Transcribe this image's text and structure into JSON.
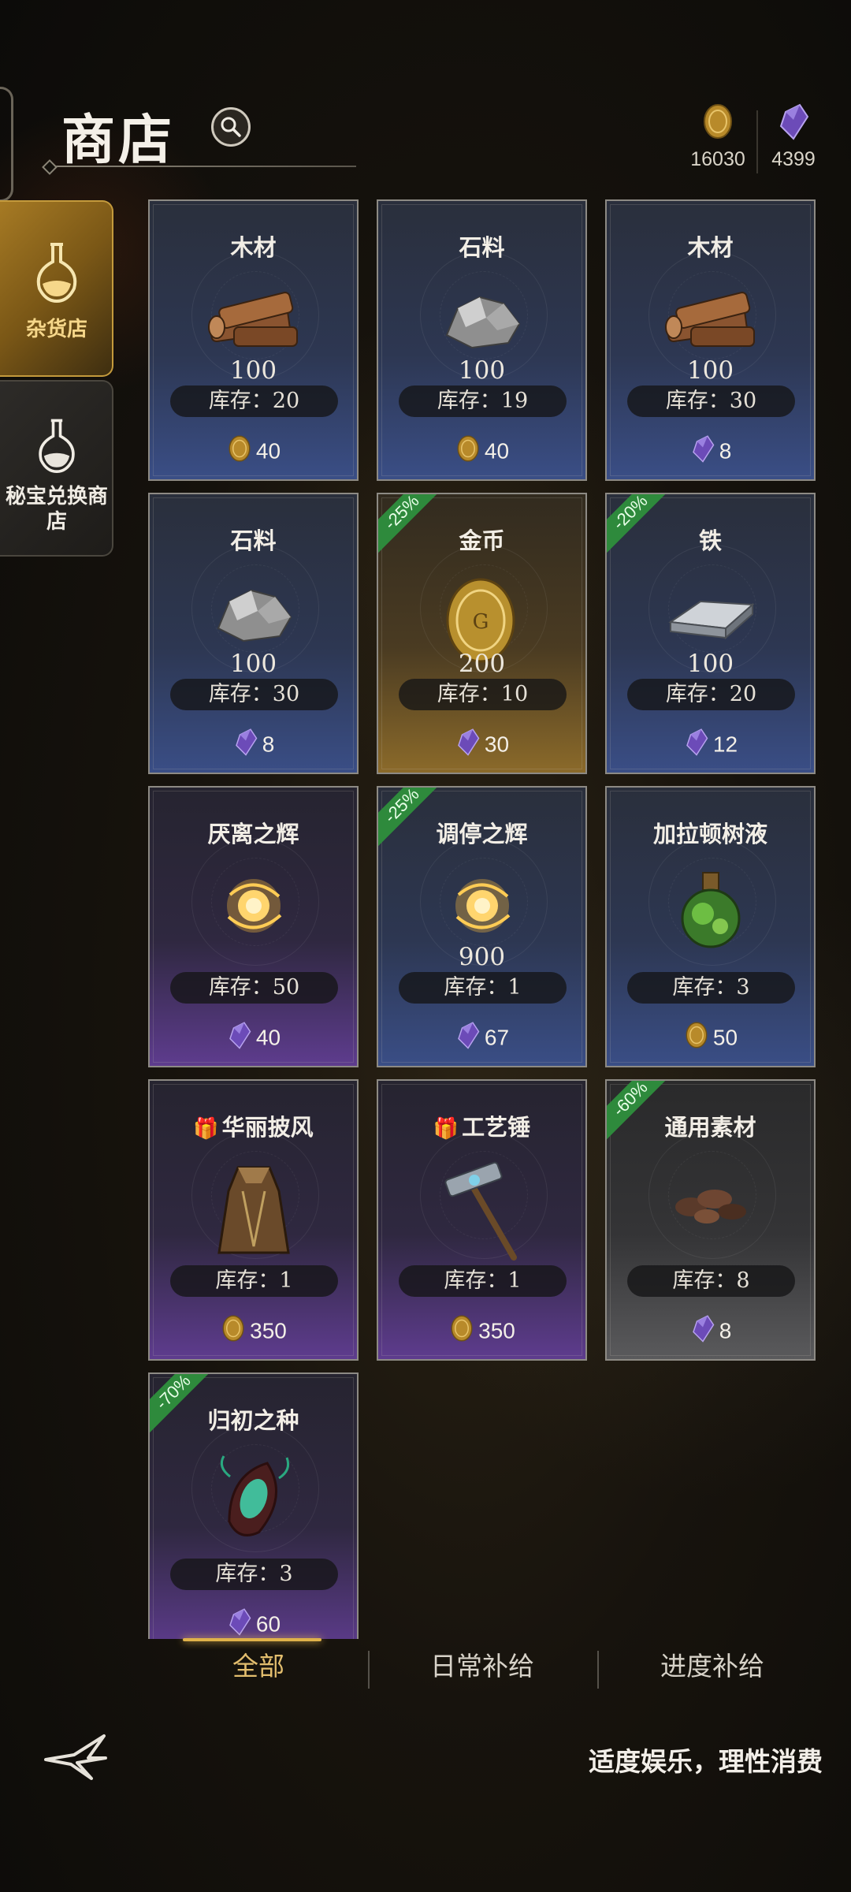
{
  "header": {
    "title": "商店",
    "currency": [
      {
        "name": "gold-coin",
        "value": "16030"
      },
      {
        "name": "purple-gem",
        "value": "4399"
      }
    ]
  },
  "sidebar": {
    "tabs": [
      {
        "label": "杂货店",
        "icon": "flask-icon",
        "active": true
      },
      {
        "label": "秘宝兑换商店",
        "icon": "flask-icon",
        "active": false
      }
    ]
  },
  "items": [
    {
      "name": "木材",
      "qty": "100",
      "stock": "库存：20",
      "price": "40",
      "currency": "gold-coin",
      "rarity": "blue",
      "icon": "wood-icon",
      "discount": "",
      "gift": false
    },
    {
      "name": "石料",
      "qty": "100",
      "stock": "库存：19",
      "price": "40",
      "currency": "gold-coin",
      "rarity": "blue",
      "icon": "stone-icon",
      "discount": "",
      "gift": false
    },
    {
      "name": "木材",
      "qty": "100",
      "stock": "库存：30",
      "price": "8",
      "currency": "purple-gem",
      "rarity": "blue",
      "icon": "wood-icon",
      "discount": "",
      "gift": false
    },
    {
      "name": "石料",
      "qty": "100",
      "stock": "库存：30",
      "price": "8",
      "currency": "purple-gem",
      "rarity": "blue",
      "icon": "stone-icon",
      "discount": "",
      "gift": false
    },
    {
      "name": "金币",
      "qty": "200",
      "stock": "库存：10",
      "price": "30",
      "currency": "purple-gem",
      "rarity": "gold",
      "icon": "gold-coin-icon",
      "discount": "-25%",
      "gift": false
    },
    {
      "name": "铁",
      "qty": "100",
      "stock": "库存：20",
      "price": "12",
      "currency": "purple-gem",
      "rarity": "blue",
      "icon": "iron-ingot-icon",
      "discount": "-20%",
      "gift": false
    },
    {
      "name": "厌离之辉",
      "qty": "",
      "stock": "库存：50",
      "price": "40",
      "currency": "purple-gem",
      "rarity": "purple",
      "icon": "radiance-icon",
      "discount": "",
      "gift": false
    },
    {
      "name": "调停之辉",
      "qty": "900",
      "stock": "库存：1",
      "price": "67",
      "currency": "purple-gem",
      "rarity": "blue",
      "icon": "radiance-icon",
      "discount": "-25%",
      "gift": false
    },
    {
      "name": "加拉顿树液",
      "qty": "",
      "stock": "库存：3",
      "price": "50",
      "currency": "gold-coin",
      "rarity": "blue",
      "icon": "potion-icon",
      "discount": "",
      "gift": false
    },
    {
      "name": "华丽披风",
      "qty": "",
      "stock": "库存：1",
      "price": "350",
      "currency": "gold-coin",
      "rarity": "purple",
      "icon": "cloak-icon",
      "discount": "",
      "gift": true
    },
    {
      "name": "工艺锤",
      "qty": "",
      "stock": "库存：1",
      "price": "350",
      "currency": "gold-coin",
      "rarity": "purple",
      "icon": "hammer-icon",
      "discount": "",
      "gift": true
    },
    {
      "name": "通用素材",
      "qty": "",
      "stock": "库存：8",
      "price": "8",
      "currency": "purple-gem",
      "rarity": "gray",
      "icon": "material-icon",
      "discount": "-60%",
      "gift": false
    },
    {
      "name": "归初之种",
      "qty": "",
      "stock": "库存：3",
      "price": "60",
      "currency": "purple-gem",
      "rarity": "purple",
      "icon": "seed-icon",
      "discount": "-70%",
      "gift": false
    }
  ],
  "bottom_tabs": [
    {
      "label": "全部",
      "active": true
    },
    {
      "label": "日常补给",
      "active": false
    },
    {
      "label": "进度补给",
      "active": false
    }
  ],
  "footer": {
    "note": "适度娱乐，理性消费"
  },
  "colors": {
    "accent_gold": "#e0b24a",
    "discount_green": "#2e8a3c",
    "rarity_blue": "#3a4e86",
    "rarity_purple": "#5e3c8e",
    "rarity_gold": "#8b6a2a",
    "rarity_gray": "#5a5a5c"
  }
}
